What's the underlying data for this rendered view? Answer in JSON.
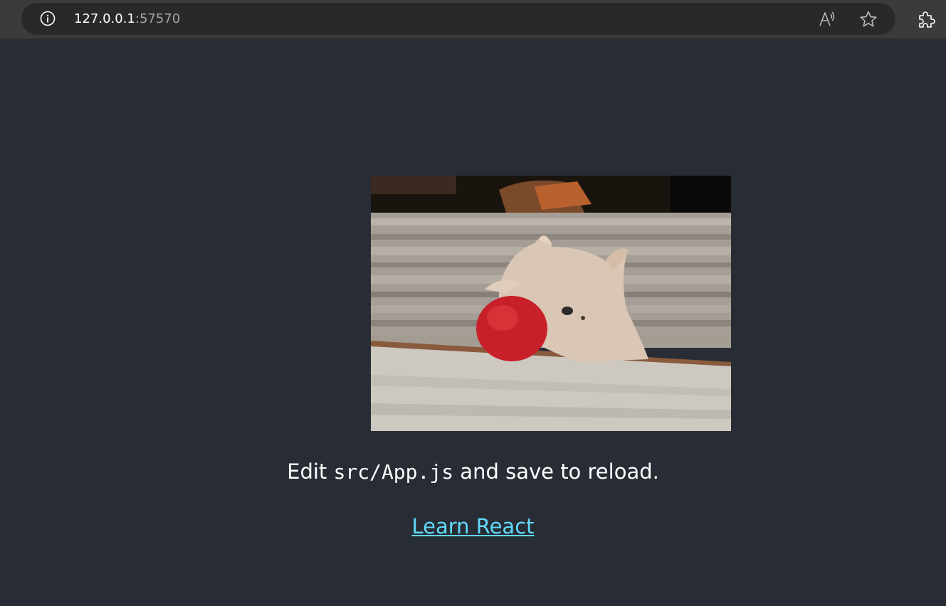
{
  "browser": {
    "url_host": "127.0.0.1",
    "url_port": ":57570",
    "icons": {
      "info": "info-icon",
      "read_aloud": "read-aloud-icon",
      "favorite": "star-icon",
      "extensions": "puzzle-icon"
    }
  },
  "app": {
    "logo_alt": "logo",
    "edit_prefix": "Edit ",
    "edit_code": "src/App.js",
    "edit_suffix": " and save to reload.",
    "link_label": "Learn React",
    "link_color": "#61dafb",
    "background_color": "#282c34"
  }
}
